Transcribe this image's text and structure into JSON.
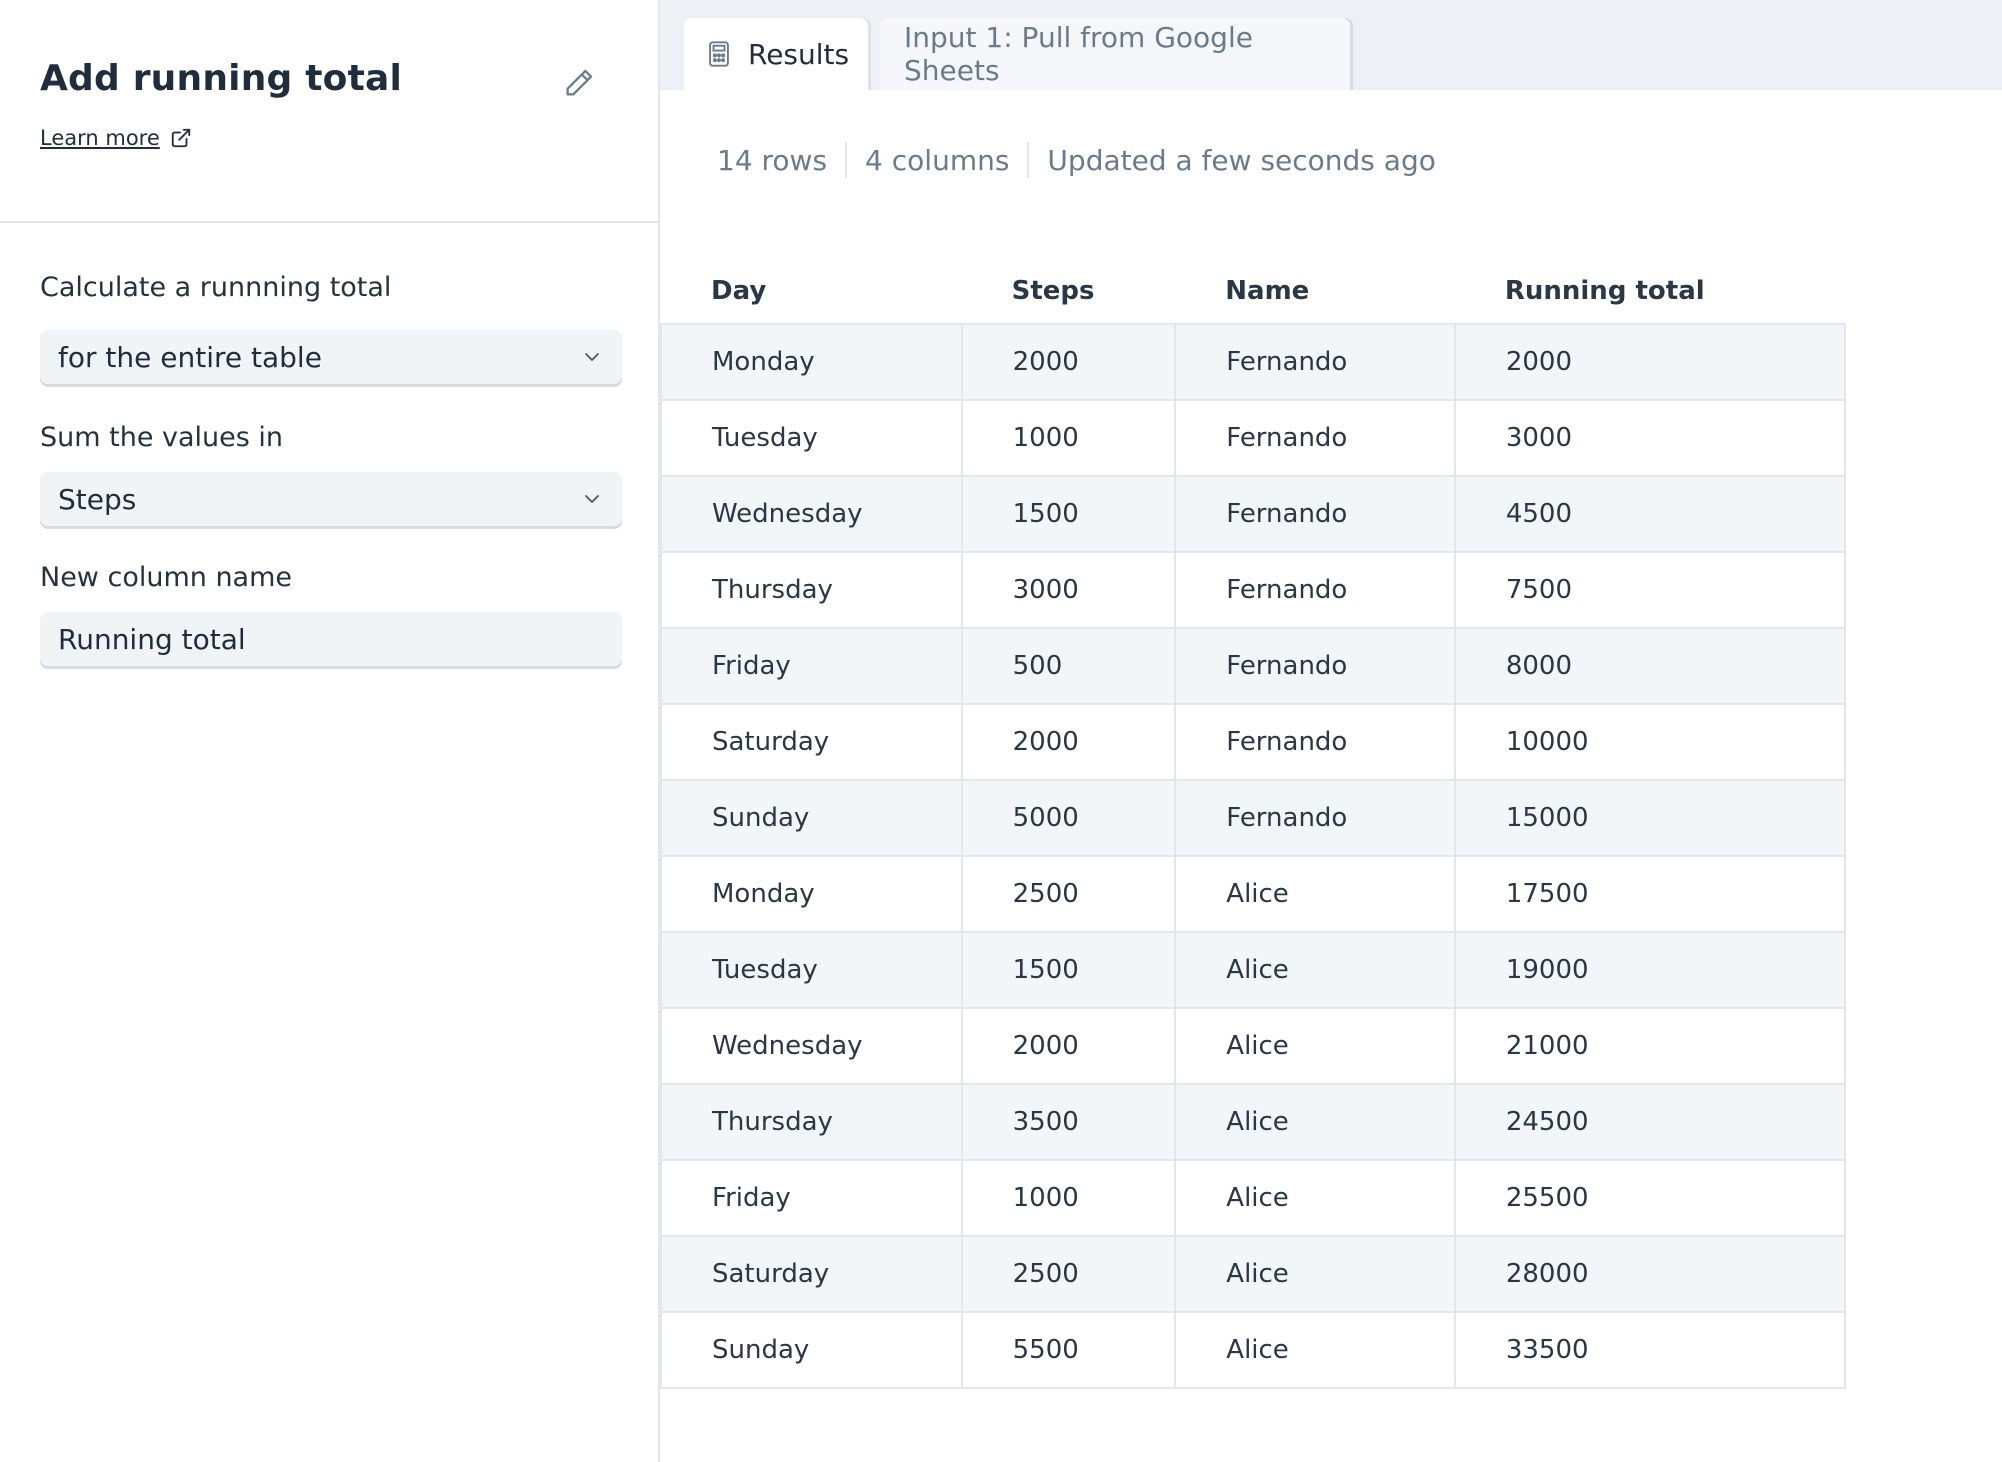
{
  "panel": {
    "title": "Add running total",
    "learn_more": "Learn more",
    "fields": {
      "calc_label": "Calculate a runnning total",
      "calc_value": "for the entire table",
      "sum_label": "Sum the values in",
      "sum_value": "Steps",
      "newcol_label": "New column name",
      "newcol_value": "Running total"
    }
  },
  "tabs": {
    "results": "Results",
    "input": "Input 1: Pull from Google Sheets"
  },
  "status": {
    "rows": "14 rows",
    "columns": "4 columns",
    "updated": "Updated a few seconds ago"
  },
  "table": {
    "headers": [
      "Day",
      "Steps",
      "Name",
      "Running total"
    ],
    "rows": [
      [
        "Monday",
        "2000",
        "Fernando",
        "2000"
      ],
      [
        "Tuesday",
        "1000",
        "Fernando",
        "3000"
      ],
      [
        "Wednesday",
        "1500",
        "Fernando",
        "4500"
      ],
      [
        "Thursday",
        "3000",
        "Fernando",
        "7500"
      ],
      [
        "Friday",
        "500",
        "Fernando",
        "8000"
      ],
      [
        "Saturday",
        "2000",
        "Fernando",
        "10000"
      ],
      [
        "Sunday",
        "5000",
        "Fernando",
        "15000"
      ],
      [
        "Monday",
        "2500",
        "Alice",
        "17500"
      ],
      [
        "Tuesday",
        "1500",
        "Alice",
        "19000"
      ],
      [
        "Wednesday",
        "2000",
        "Alice",
        "21000"
      ],
      [
        "Thursday",
        "3500",
        "Alice",
        "24500"
      ],
      [
        "Friday",
        "1000",
        "Alice",
        "25500"
      ],
      [
        "Saturday",
        "2500",
        "Alice",
        "28000"
      ],
      [
        "Sunday",
        "5500",
        "Alice",
        "33500"
      ]
    ]
  },
  "icons": {
    "edit": "pencil-icon",
    "external_link": "external-link-icon",
    "chevron": "chevron-down-icon",
    "results_tab": "calculator-icon"
  }
}
